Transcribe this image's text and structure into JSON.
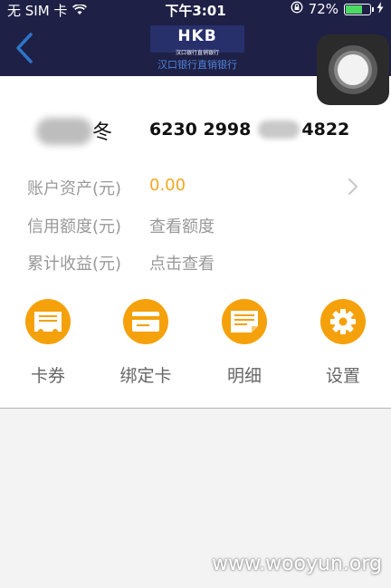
{
  "status_bar": {
    "carrier": "无 SIM 卡",
    "time": "下午3:01",
    "battery_percent": "72%",
    "battery_level": 0.72,
    "icons": [
      "wifi-icon",
      "rotation-lock-icon",
      "battery-icon",
      "charging-icon"
    ]
  },
  "nav": {
    "back_icon": "chevron-left-icon",
    "logo": {
      "main": "HKB",
      "sub": "汉口银行直销银行",
      "sub2": "汉口银行直销银行"
    }
  },
  "account": {
    "name_suffix": "冬",
    "card_number_start": "6230 2998",
    "card_number_end": "4822",
    "rows": [
      {
        "label": "账户资产(元)",
        "value": "0.00"
      },
      {
        "label": "信用额度(元)",
        "value": "查看额度"
      },
      {
        "label": "累计收益(元)",
        "value": "点击查看"
      }
    ]
  },
  "shortcuts": [
    {
      "label": "卡券",
      "icon": "coupon-icon"
    },
    {
      "label": "绑定卡",
      "icon": "bank-card-icon"
    },
    {
      "label": "明细",
      "icon": "details-icon"
    },
    {
      "label": "设置",
      "icon": "gear-icon"
    }
  ],
  "watermark": "www.wooyun.org",
  "colors": {
    "nav_bg": "#1e2046",
    "accent_orange": "#f5a10b",
    "value_orange": "#f5a623",
    "back_arrow": "#2f74c9"
  }
}
